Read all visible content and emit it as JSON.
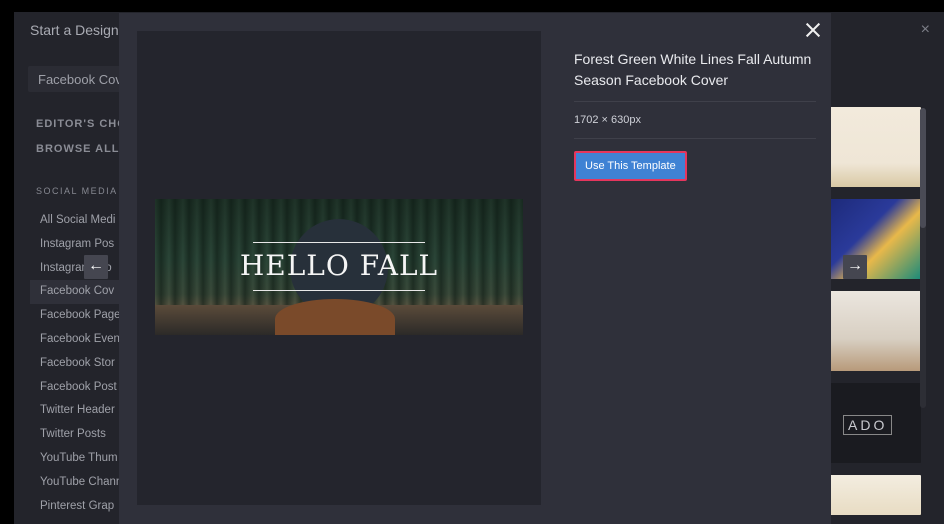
{
  "background": {
    "title": "Start a Design",
    "close_glyph": "×",
    "search_value": "Facebook Cov",
    "editors_choice": "EDITOR'S CHOIC",
    "browse_all": "BROWSE ALL TE",
    "section_label": "SOCIAL MEDIA",
    "items": [
      "All Social Medi",
      "Instagram Pos",
      "Instagram Sto",
      "Facebook Cov",
      "Facebook Page",
      "Facebook Even",
      "Facebook Stor",
      "Facebook Post",
      "Twitter Header",
      "Twitter Posts",
      "YouTube Thum",
      "YouTube Chann",
      "Pinterest Grap"
    ],
    "active_index": 3,
    "thumbnail_text": "ADO"
  },
  "modal": {
    "template_title": "Forest Green White Lines Fall Autumn Season Facebook Cover",
    "dimensions": "1702 × 630px",
    "use_button": "Use This Template",
    "banner_text": "HELLO FALL",
    "prev_glyph": "←",
    "next_glyph": "→",
    "accent_color": "#3f82d4",
    "highlight_color": "#e5365d"
  }
}
